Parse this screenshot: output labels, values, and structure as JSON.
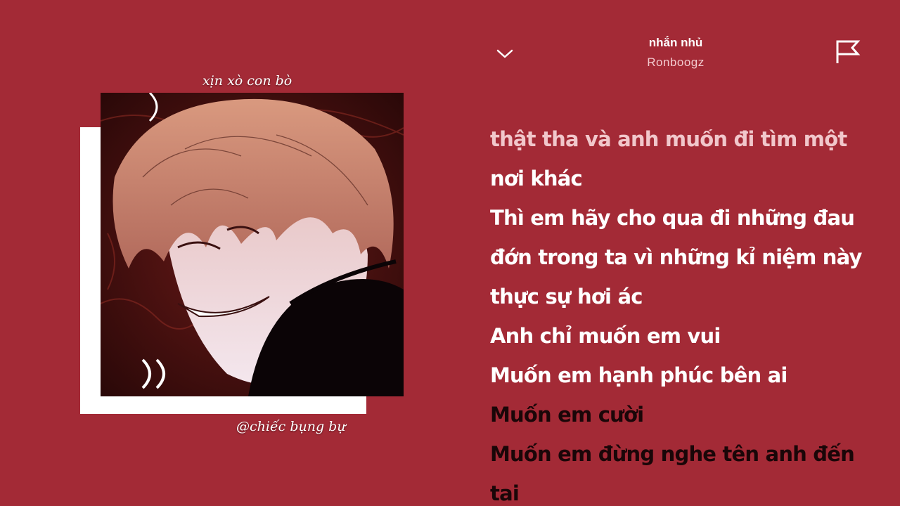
{
  "artwork": {
    "caption_top": "xịn xò con bò",
    "caption_bottom": "@chiếc bụng bự"
  },
  "header": {
    "title": "nhắn nhủ",
    "artist": "Ronboogz",
    "collapse_icon": "chevron-down-icon",
    "report_icon": "flag-icon"
  },
  "lyrics": {
    "lines": [
      {
        "text": "thật tha và anh muốn đi tìm một",
        "state": "faded"
      },
      {
        "text": "nơi khác",
        "state": "past"
      },
      {
        "text": "Thì em hãy cho qua đi những đau",
        "state": "past"
      },
      {
        "text": "đớn trong ta vì những kỉ niệm này",
        "state": "past"
      },
      {
        "text": "thực sự hơi ác",
        "state": "past"
      },
      {
        "text": "Anh chỉ muốn em vui",
        "state": "past"
      },
      {
        "text": "Muốn em hạnh phúc bên ai",
        "state": "past"
      },
      {
        "text": "Muốn em cười",
        "state": "upcoming"
      },
      {
        "text": "Muốn em đừng nghe tên anh đến",
        "state": "upcoming"
      },
      {
        "text": "tai",
        "state": "upcoming"
      }
    ]
  },
  "colors": {
    "background": "#a32a36",
    "lyric_past": "#ffffff",
    "lyric_upcoming": "#1a0608"
  }
}
